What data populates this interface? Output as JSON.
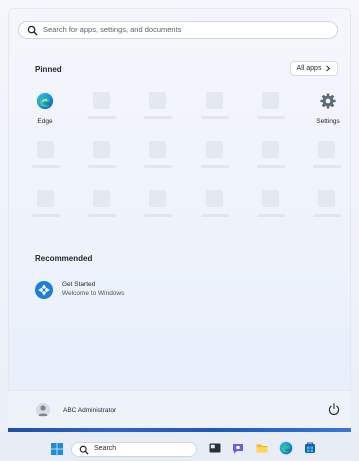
{
  "search": {
    "placeholder": "Search for apps, settings, and documents"
  },
  "pinned": {
    "title": "Pinned",
    "all_apps_label": "All apps",
    "apps": [
      {
        "label": "Edge",
        "icon": "edge-icon"
      },
      {
        "label": "Settings",
        "icon": "gear-icon"
      }
    ]
  },
  "recommended": {
    "title": "Recommended",
    "items": [
      {
        "title": "Get Started",
        "subtitle": "Welcome to Windows",
        "icon": "get-started-icon"
      }
    ]
  },
  "footer": {
    "user_name": "ABC Administrator"
  },
  "taskbar": {
    "search_label": "Search",
    "icons": [
      "windows-start-icon",
      "search-icon",
      "task-view-icon",
      "chat-icon",
      "file-explorer-icon",
      "edge-icon",
      "store-icon"
    ]
  },
  "colors": {
    "accent": "#1e6fd9",
    "background": "#f3f6fb"
  }
}
